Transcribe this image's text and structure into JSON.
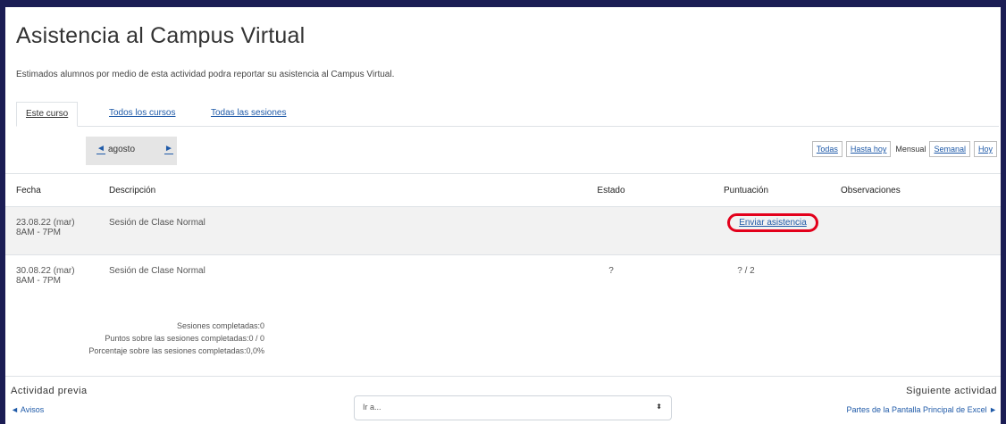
{
  "page": {
    "title": "Asistencia al Campus Virtual",
    "intro": "Estimados alumnos por medio de esta actividad podra reportar su asistencia al Campus Virtual."
  },
  "tabs": [
    {
      "label": "Este curso",
      "active": true
    },
    {
      "label": "Todos los cursos",
      "active": false
    },
    {
      "label": "Todas las sesiones",
      "active": false
    }
  ],
  "month_nav": {
    "prev": "◄",
    "label": "agosto",
    "next": "►"
  },
  "view_buttons": {
    "all": "Todas",
    "until_today": "Hasta hoy",
    "monthly": "Mensual",
    "weekly": "Semanal",
    "today": "Hoy"
  },
  "table": {
    "headers": {
      "fecha": "Fecha",
      "descripcion": "Descripción",
      "estado": "Estado",
      "puntuacion": "Puntuación",
      "observaciones": "Observaciones"
    },
    "rows": [
      {
        "date": "23.08.22 (mar)",
        "time": "8AM - 7PM",
        "description": "Sesión de Clase Normal",
        "status": "",
        "score": "",
        "action": "Enviar asistencia",
        "notes": ""
      },
      {
        "date": "30.08.22 (mar)",
        "time": "8AM - 7PM",
        "description": "Sesión de Clase Normal",
        "status": "?",
        "score": "? / 2",
        "action": "",
        "notes": ""
      }
    ]
  },
  "summary": {
    "completed": "Sesiones completadas:0",
    "points": "Puntos sobre las sesiones completadas:0 / 0",
    "percentage": "Porcentaje sobre las sesiones completadas:0,0%"
  },
  "footer": {
    "prev_label": "Actividad previa",
    "prev_link": "◄ Avisos",
    "jump_placeholder": "Ir a...",
    "jump_caret": "⬍",
    "next_label": "Siguiente actividad",
    "next_link": "Partes de la Pantalla Principal de Excel ►"
  },
  "colors": {
    "frame": "#1b1d54",
    "link": "#1f5aa8",
    "highlight": "#e3001b"
  }
}
